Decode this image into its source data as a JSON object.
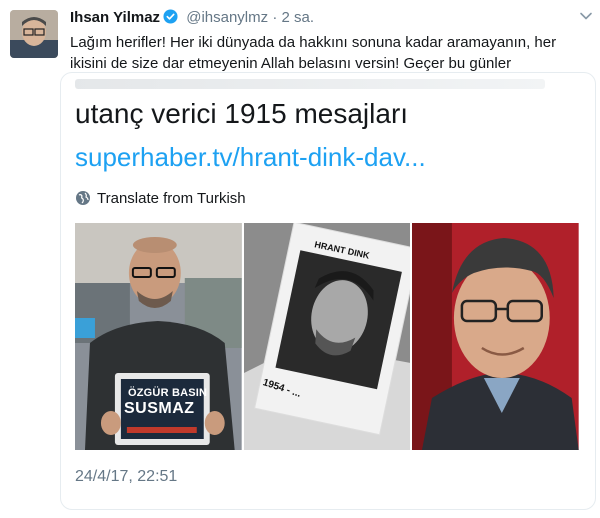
{
  "tweet": {
    "author_name": "Ihsan Yilmaz",
    "handle": "@ihsanylmz",
    "separator": "·",
    "time": "2 sa.",
    "text": "Lağım herifler! Her iki dünyada da hakkını sonuna kadar aramayanın, her ikisini de size dar etmeyenin Allah belasını versin! Geçer bu günler",
    "icons": [
      "avatar",
      "verified-badge-icon",
      "chevron-down-icon"
    ]
  },
  "embed": {
    "title": "utanç verici 1915 mesajları",
    "link": "superhaber.tv/hrant-dink-dav...",
    "translate_label": "Translate from Turkish",
    "photos": [
      {
        "sign_line1": "ÖZGÜR BASIN",
        "sign_line2": "SUSMAZ"
      },
      {
        "card_name": "HRANT DINK",
        "card_years": "1954 - ..."
      },
      {}
    ],
    "timestamp": "24/4/17, 22:51"
  },
  "colors": {
    "link": "#1da1f2",
    "secondary_text": "#657786",
    "verified": "#1da1f2",
    "border": "#e6ecf0"
  }
}
